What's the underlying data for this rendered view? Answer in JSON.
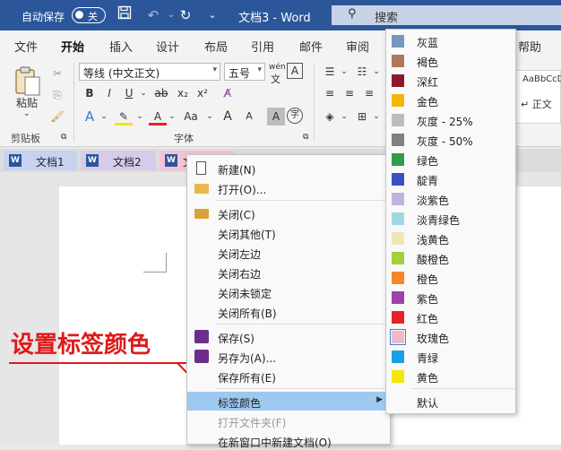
{
  "titlebar": {
    "autosave_label": "自动保存",
    "autosave_state": "关",
    "doc_title": "文档3 - Word",
    "search_label": "搜索"
  },
  "menu_tabs": [
    "文件",
    "开始",
    "插入",
    "设计",
    "布局",
    "引用",
    "邮件",
    "审阅",
    "帮助"
  ],
  "ribbon": {
    "paste_label": "粘贴",
    "clipboard_label": "剪贴板",
    "font_name": "等线 (中文正文)",
    "font_size": "五号",
    "font_group_label": "字体",
    "wen_label": "wén",
    "style_preview": "AaBbCcDd",
    "style_name": "正文",
    "bold": "B",
    "italic": "I",
    "underline": "U",
    "strike": "ab",
    "subscript": "x₂",
    "superscript": "x²",
    "case": "Aa",
    "grow": "A",
    "shrink": "A"
  },
  "doc_tabs": [
    {
      "label": "文档1",
      "color": "#c7d3ee"
    },
    {
      "label": "文档2",
      "color": "#d6cbe8"
    },
    {
      "label": "文",
      "color": "#f3c2d7"
    }
  ],
  "context_menu": {
    "items": [
      {
        "label": "新建(N)",
        "icon": "new-doc-icon"
      },
      {
        "label": "打开(O)...",
        "icon": "folder-open-icon"
      },
      {
        "label": "关闭(C)",
        "icon": "close-folder-icon"
      },
      {
        "label": "关闭其他(T)"
      },
      {
        "label": "关闭左边"
      },
      {
        "label": "关闭右边"
      },
      {
        "label": "关闭未锁定"
      },
      {
        "label": "关闭所有(B)"
      },
      {
        "label": "保存(S)",
        "icon": "save-icon"
      },
      {
        "label": "另存为(A)...",
        "icon": "save-as-icon"
      },
      {
        "label": "保存所有(E)"
      },
      {
        "label": "标签颜色",
        "highlighted": true
      },
      {
        "label": "打开文件夹(F)",
        "disabled": true
      },
      {
        "label": "在新窗口中新建文档(O)"
      }
    ]
  },
  "color_menu": {
    "items": [
      {
        "label": "灰蓝",
        "color": "#7896be"
      },
      {
        "label": "褐色",
        "color": "#b0785a"
      },
      {
        "label": "深红",
        "color": "#8b1a2e"
      },
      {
        "label": "金色",
        "color": "#f2b705"
      },
      {
        "label": "灰度 - 25%",
        "color": "#bcbcbc"
      },
      {
        "label": "灰度 - 50%",
        "color": "#808080"
      },
      {
        "label": "绿色",
        "color": "#2e9e49"
      },
      {
        "label": "靛青",
        "color": "#3b4fc4"
      },
      {
        "label": "淡紫色",
        "color": "#bfb3dc"
      },
      {
        "label": "淡青绿色",
        "color": "#9fd8e3"
      },
      {
        "label": "浅黄色",
        "color": "#efe6b5"
      },
      {
        "label": "酸橙色",
        "color": "#a4d03c"
      },
      {
        "label": "橙色",
        "color": "#f5872a"
      },
      {
        "label": "紫色",
        "color": "#a040a8"
      },
      {
        "label": "红色",
        "color": "#e8212b"
      },
      {
        "label": "玫瑰色",
        "color": "#f4b6cb",
        "selected": true
      },
      {
        "label": "青绿",
        "color": "#1aa0e0"
      },
      {
        "label": "黄色",
        "color": "#f5e60a"
      }
    ],
    "default_label": "默认"
  },
  "annotation": {
    "text": "设置标签颜色",
    "color": "#e11919"
  }
}
